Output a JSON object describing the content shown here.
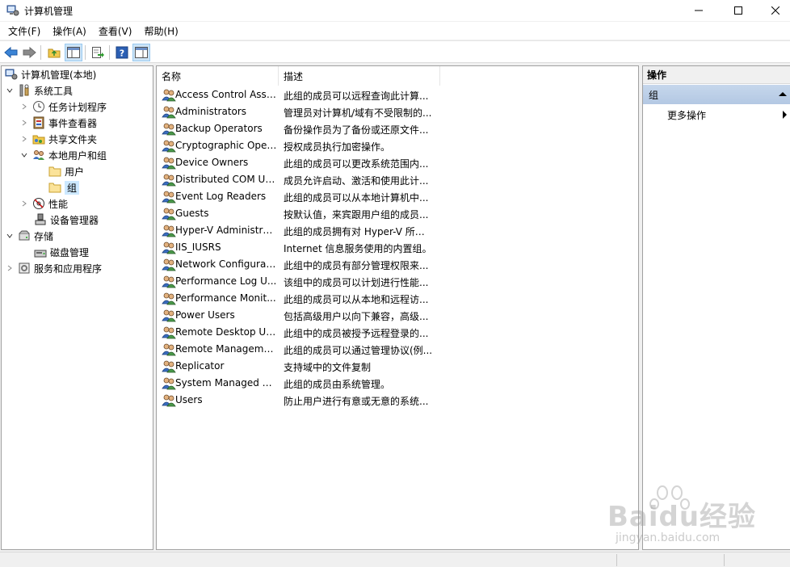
{
  "window": {
    "title": "计算机管理",
    "icon": "computer-management-icon"
  },
  "menu": [
    {
      "label": "文件(F)"
    },
    {
      "label": "操作(A)"
    },
    {
      "label": "查看(V)"
    },
    {
      "label": "帮助(H)"
    }
  ],
  "toolbar": {
    "buttons": [
      "back-icon",
      "forward-icon",
      "up-folder-icon",
      "show-hide-tree-icon",
      "export-list-icon",
      "help-icon",
      "show-hide-action-pane-icon"
    ]
  },
  "tree": {
    "items": [
      {
        "label": "计算机管理(本地)",
        "icon": "computer-management-icon"
      },
      {
        "label": "系统工具",
        "icon": "tools-icon",
        "expanded": true
      },
      {
        "label": "任务计划程序",
        "icon": "clock-icon"
      },
      {
        "label": "事件查看器",
        "icon": "event-viewer-icon"
      },
      {
        "label": "共享文件夹",
        "icon": "shared-folder-icon"
      },
      {
        "label": "本地用户和组",
        "icon": "users-icon",
        "expanded": true
      },
      {
        "label": "用户",
        "icon": "folder-icon"
      },
      {
        "label": "组",
        "icon": "folder-icon",
        "selected": true
      },
      {
        "label": "性能",
        "icon": "performance-icon"
      },
      {
        "label": "设备管理器",
        "icon": "device-manager-icon"
      },
      {
        "label": "存储",
        "icon": "storage-icon",
        "expanded": true
      },
      {
        "label": "磁盘管理",
        "icon": "disk-icon"
      },
      {
        "label": "服务和应用程序",
        "icon": "services-icon"
      }
    ]
  },
  "list": {
    "columns": {
      "name": "名称",
      "description": "描述"
    },
    "rows": [
      {
        "name": "Access Control Assi...",
        "description": "此组的成员可以远程查询此计算..."
      },
      {
        "name": "Administrators",
        "description": "管理员对计算机/域有不受限制的..."
      },
      {
        "name": "Backup Operators",
        "description": "备份操作员为了备份或还原文件..."
      },
      {
        "name": "Cryptographic Oper...",
        "description": "授权成员执行加密操作。"
      },
      {
        "name": "Device Owners",
        "description": "此组的成员可以更改系统范围内..."
      },
      {
        "name": "Distributed COM Us...",
        "description": "成员允许启动、激活和使用此计..."
      },
      {
        "name": "Event Log Readers",
        "description": "此组的成员可以从本地计算机中..."
      },
      {
        "name": "Guests",
        "description": "按默认值，来宾跟用户组的成员..."
      },
      {
        "name": "Hyper-V Administra...",
        "description": "此组的成员拥有对 Hyper-V 所有..."
      },
      {
        "name": "IIS_IUSRS",
        "description": "Internet 信息服务使用的内置组。"
      },
      {
        "name": "Network Configurat...",
        "description": "此组中的成员有部分管理权限来..."
      },
      {
        "name": "Performance Log U...",
        "description": "该组中的成员可以计划进行性能..."
      },
      {
        "name": "Performance Monit...",
        "description": "此组的成员可以从本地和远程访..."
      },
      {
        "name": "Power Users",
        "description": "包括高级用户以向下兼容，高级..."
      },
      {
        "name": "Remote Desktop Us...",
        "description": "此组中的成员被授予远程登录的..."
      },
      {
        "name": "Remote Manageme...",
        "description": "此组的成员可以通过管理协议(例..."
      },
      {
        "name": "Replicator",
        "description": "支持域中的文件复制"
      },
      {
        "name": "System Managed A...",
        "description": "此组的成员由系统管理。"
      },
      {
        "name": "Users",
        "description": "防止用户进行有意或无意的系统..."
      }
    ]
  },
  "actions": {
    "header": "操作",
    "section": "组",
    "items": [
      {
        "label": "更多操作"
      }
    ]
  },
  "watermark": {
    "text": "Baidu经验",
    "url": "jingyan.baidu.com"
  }
}
